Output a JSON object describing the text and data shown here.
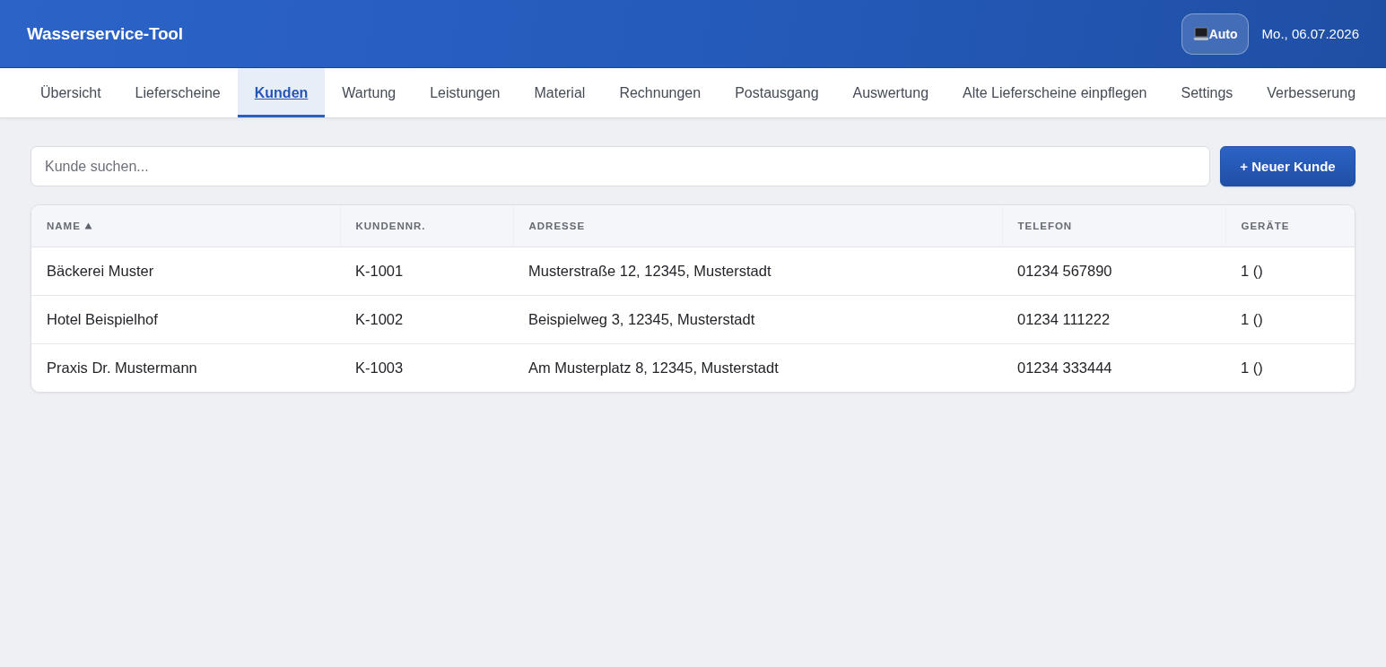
{
  "header": {
    "title": "Wasserservice-Tool",
    "theme_button": {
      "label": "Auto"
    },
    "date": "Mo., 06.07.2026"
  },
  "tabs": [
    {
      "label": "Übersicht",
      "selected": false
    },
    {
      "label": "Lieferscheine",
      "selected": false
    },
    {
      "label": "Kunden",
      "selected": true
    },
    {
      "label": "Wartung",
      "selected": false
    },
    {
      "label": "Leistungen",
      "selected": false
    },
    {
      "label": "Material",
      "selected": false
    },
    {
      "label": "Rechnungen",
      "selected": false
    },
    {
      "label": "Postausgang",
      "selected": false
    },
    {
      "label": "Auswertung",
      "selected": false
    },
    {
      "label": "Alte Lieferscheine einpflegen",
      "selected": false
    },
    {
      "label": "Settings",
      "selected": false
    },
    {
      "label": "Verbesserung",
      "selected": false
    }
  ],
  "search": {
    "placeholder": "Kunde suchen..."
  },
  "new_button": {
    "label": "+ Neuer Kunde"
  },
  "table": {
    "columns": [
      {
        "label": "NAME",
        "sorted": true
      },
      {
        "label": "KUNDENNR.",
        "sorted": false
      },
      {
        "label": "ADRESSE",
        "sorted": false
      },
      {
        "label": "TELEFON",
        "sorted": false
      },
      {
        "label": "GERÄTE",
        "sorted": false
      }
    ],
    "rows": [
      [
        "Bäckerei Muster",
        "K-1001",
        "Musterstraße 12, 12345, Musterstadt",
        "01234 567890",
        "1 ()"
      ],
      [
        "Hotel Beispielhof",
        "K-1002",
        "Beispielweg 3, 12345, Musterstadt",
        "01234 111222",
        "1 ()"
      ],
      [
        "Praxis Dr. Mustermann",
        "K-1003",
        "Am Musterplatz 8, 12345, Musterstadt",
        "01234 333444",
        "1 ()"
      ]
    ]
  }
}
